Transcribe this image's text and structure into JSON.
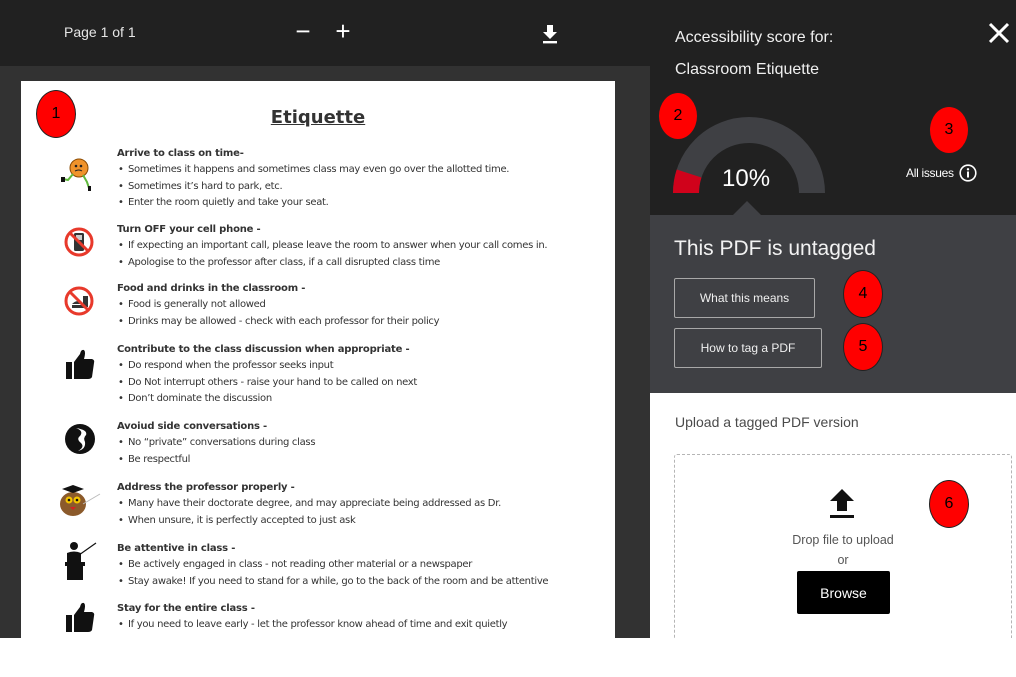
{
  "viewer": {
    "page_indicator": "Page 1 of 1",
    "zoom_out_label": "−",
    "zoom_in_label": "+",
    "download_icon": "download-icon"
  },
  "document": {
    "title": "Etiquette",
    "sections": [
      {
        "icon": "running-clock-icon",
        "heading": "Arrive to class on time-",
        "bullets": [
          "Sometimes it happens and sometimes class may even go over the allotted time.",
          "Sometimes it’s hard to park, etc.",
          "Enter the room quietly and take your seat."
        ]
      },
      {
        "icon": "no-phone-icon",
        "heading": "Turn OFF your cell phone -",
        "bullets": [
          "If expecting an important call, please leave the room to answer when your call comes in.",
          "Apologise to the professor after class, if a call disrupted class time"
        ]
      },
      {
        "icon": "no-food-icon",
        "heading": "Food and drinks in the classroom -",
        "bullets": [
          "Food is generally not allowed",
          "Drinks may be allowed - check with each professor for their policy"
        ]
      },
      {
        "icon": "thumbs-up-icon",
        "heading": "Contribute to the class discussion when appropriate -",
        "bullets": [
          "Do respond when the professor seeks input",
          "Do Not interrupt others - raise your hand to be called on next",
          "Don’t dominate the discussion"
        ]
      },
      {
        "icon": "conversation-faces-icon",
        "heading": "Avoiud side conversations -",
        "bullets": [
          "No “private” conversations during class",
          "Be respectful"
        ]
      },
      {
        "icon": "owl-professor-icon",
        "heading": "Address the professor properly -",
        "bullets": [
          "Many have their doctorate degree, and may appreciate being addressed as Dr.",
          "When unsure, it is perfectly accepted to just ask"
        ]
      },
      {
        "icon": "teacher-podium-icon",
        "heading": "Be attentive in class -",
        "bullets": [
          "Be actively engaged in class - not reading other material or a newspaper",
          "Stay awake! If you need to stand for a while, go to the back of the room and be attentive"
        ]
      },
      {
        "icon": "thumbs-up-icon",
        "heading": "Stay for the entire class -",
        "bullets": [
          "If you need to leave early - let the professor know ahead of time and exit quietly"
        ]
      }
    ]
  },
  "panel": {
    "title_line1": "Accessibility score for:",
    "title_line2": "Classroom Etiquette",
    "score_label": "10%",
    "score_fraction": 0.1,
    "all_issues_label": "All issues",
    "status_heading": "This PDF is untagged",
    "what_this_means_label": "What this means",
    "how_to_tag_label": "How to tag a PDF",
    "upload_label": "Upload a tagged PDF version",
    "drop_text": "Drop file to upload",
    "or_text": "or",
    "browse_label": "Browse"
  },
  "colors": {
    "toolbar_bg": "#212121",
    "viewer_bg": "#323232",
    "panel_mid_bg": "#3f4044",
    "gauge_track": "#3f4044",
    "gauge_fill": "#d0021b",
    "marker_red": "#ff0000"
  },
  "markers": [
    "1",
    "2",
    "3",
    "4",
    "5",
    "6"
  ]
}
